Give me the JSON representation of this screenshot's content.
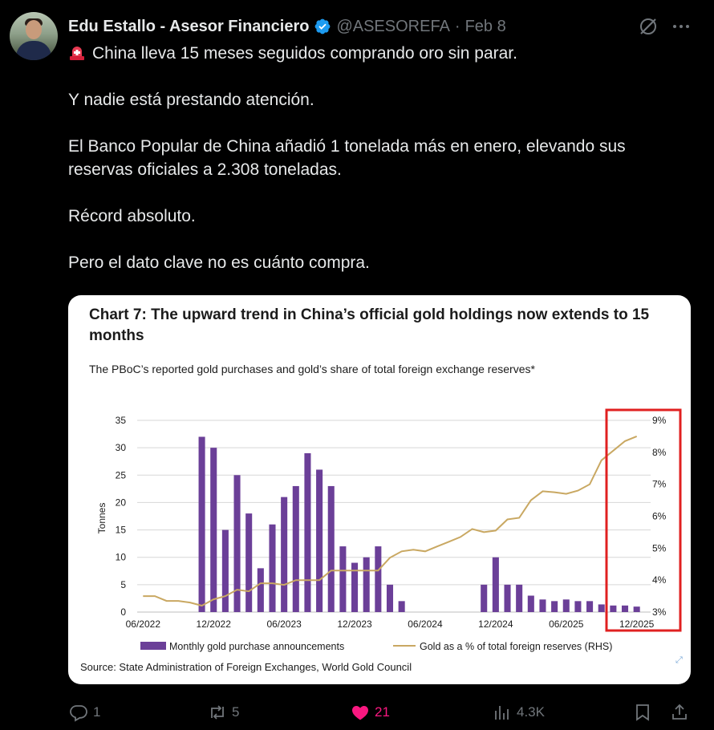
{
  "author": {
    "name": "Edu Estallo - Asesor Financiero",
    "handle": "@ASESOREFA",
    "separator": "·",
    "date": "Feb 8"
  },
  "tweet": {
    "line1": "China lleva 15 meses seguidos comprando oro sin parar.",
    "line2": "Y nadie está prestando atención.",
    "line3a": "El Banco Popular de China añadió 1 tonelada más en enero, elevando sus",
    "line3b": "reservas oficiales a 2.308 toneladas.",
    "line4": "Récord absoluto.",
    "line5": "Pero el dato clave no es cuánto compra."
  },
  "card": {
    "title": "Chart 7: The upward trend in China’s official gold holdings now extends to 15 months",
    "subtitle": "The PBoC’s reported gold purchases and gold’s share of total foreign exchange reserves*",
    "source": "Source: State Administration of Foreign Exchanges, World Gold Council"
  },
  "chart_data": {
    "type": "bar",
    "x_ticks": [
      "06/2022",
      "12/2022",
      "06/2023",
      "12/2023",
      "06/2024",
      "12/2024",
      "06/2025",
      "12/2025"
    ],
    "ylabel": "Tonnes",
    "ylim": [
      0,
      35
    ],
    "y_ticks": [
      "0",
      "5",
      "10",
      "15",
      "20",
      "25",
      "30",
      "35"
    ],
    "y2lim": [
      3,
      9
    ],
    "y2_ticks": [
      "3%",
      "4%",
      "5%",
      "6%",
      "7%",
      "8%",
      "9%"
    ],
    "series": [
      {
        "name": "Monthly gold purchase announcements",
        "type": "bar",
        "color": "#6b3f98",
        "values": [
          0,
          0,
          0,
          0,
          0,
          32,
          30,
          15,
          25,
          18,
          8,
          16,
          21,
          23,
          29,
          26,
          23,
          12,
          9,
          10,
          12,
          5,
          2,
          0,
          0,
          0,
          0,
          0,
          0,
          5,
          10,
          5,
          5,
          3,
          2.3,
          2,
          2.3,
          2,
          2,
          1.4,
          1.2,
          1.2,
          1
        ]
      },
      {
        "name": "Gold as a % of total foreign reserves (RHS)",
        "type": "line",
        "color": "#c9a862",
        "values": [
          3.5,
          3.5,
          3.35,
          3.35,
          3.3,
          3.2,
          3.4,
          3.5,
          3.7,
          3.65,
          3.9,
          3.9,
          3.85,
          4.0,
          4.0,
          4.0,
          4.3,
          4.3,
          4.3,
          4.3,
          4.3,
          4.7,
          4.9,
          4.95,
          4.9,
          5.05,
          5.2,
          5.35,
          5.6,
          5.5,
          5.55,
          5.9,
          5.95,
          6.5,
          6.78,
          6.75,
          6.7,
          6.8,
          7.0,
          7.75,
          8.05,
          8.35,
          8.5
        ]
      }
    ],
    "highlight_box_color": "#e02020",
    "grid": true,
    "legend_placement": "bottom"
  },
  "actions": {
    "replies": "1",
    "reposts": "5",
    "likes": "21",
    "views": "4.3K"
  },
  "colors": {
    "like_active": "#f91880",
    "muted": "#71767b",
    "verified": "#1d9bf0"
  }
}
